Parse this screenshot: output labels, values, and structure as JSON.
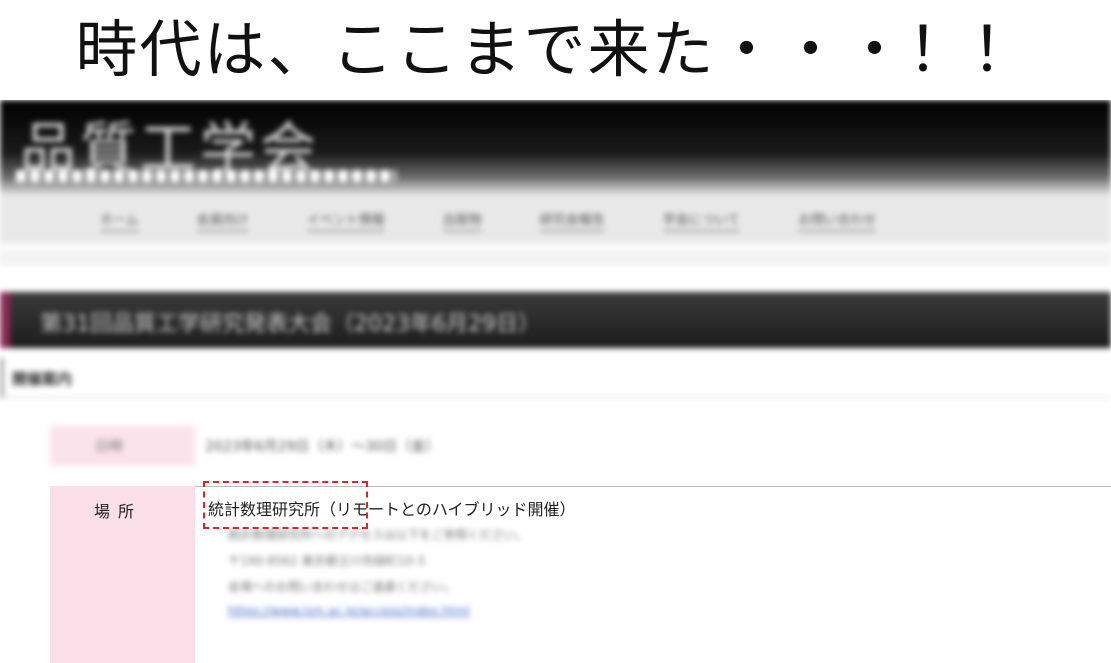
{
  "headline": "時代は、ここまで来た・・・！！",
  "site": {
    "logo_text": "品質工学会",
    "nav_items": [
      "ホーム",
      "会員向け",
      "イベント情報",
      "出版物",
      "研究会報告",
      "学会について",
      "お問い合わせ"
    ],
    "page_title": "第31回品質工学研究発表大会（2023年6月29日）",
    "section_title": "開催案内",
    "rows": {
      "date": {
        "label": "日時",
        "value": "2023年6月29日（木）～30日（金）"
      },
      "place": {
        "label": "場所",
        "value": "統計数理研究所（リモートとのハイブリッド開催）",
        "details": [
          "統計数理研究所へのアクセスは以下をご参照ください。",
          "〒190-8562 東京都立川市緑町10-3",
          "会場へのお問い合わせはご遠慮ください。"
        ],
        "link": "https://www.ism.ac.jp/access/index.html"
      }
    }
  },
  "colors": {
    "title_accent": "#8a2c55",
    "label_bg": "#fbdfe8",
    "callout": "#d62728"
  }
}
